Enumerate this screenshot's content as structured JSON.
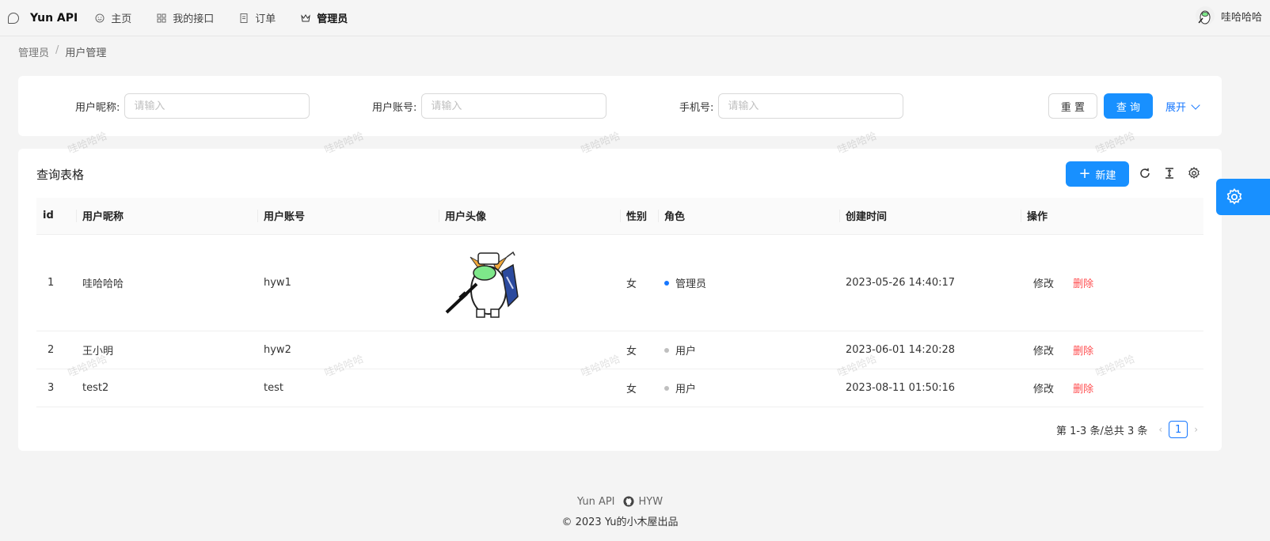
{
  "app": {
    "title": "Yun API"
  },
  "nav": [
    {
      "label": "主页",
      "icon": "smile-icon"
    },
    {
      "label": "我的接口",
      "icon": "apps-icon"
    },
    {
      "label": "订单",
      "icon": "file-icon"
    },
    {
      "label": "管理员",
      "icon": "crown-icon"
    }
  ],
  "user": {
    "name": "哇哈哈哈"
  },
  "breadcrumb": [
    "管理员",
    "用户管理"
  ],
  "breadcrumb_sep": "/",
  "search": {
    "nickname_label": "用户昵称:",
    "account_label": "用户账号:",
    "phone_label": "手机号:",
    "placeholder": "请输入",
    "reset_label": "重 置",
    "query_label": "查 询",
    "expand_label": "展开"
  },
  "table_card": {
    "title": "查询表格",
    "new_label": "新建",
    "new_icon": "plus-icon",
    "tools": [
      "reload-icon",
      "column-height-icon",
      "setting-icon"
    ]
  },
  "table": {
    "columns": [
      "id",
      "用户昵称",
      "用户账号",
      "用户头像",
      "性别",
      "角色",
      "创建时间",
      "操作"
    ],
    "rows": [
      {
        "id": "1",
        "nickname": "哇哈哈哈",
        "account": "hyw1",
        "has_avatar": true,
        "gender": "女",
        "role": "管理员",
        "role_color": "#1677ff",
        "created": "2023-05-26 14:40:17"
      },
      {
        "id": "2",
        "nickname": "王小明",
        "account": "hyw2",
        "has_avatar": false,
        "gender": "女",
        "role": "用户",
        "role_color": "#bfbfbf",
        "created": "2023-06-01 14:20:28"
      },
      {
        "id": "3",
        "nickname": "test2",
        "account": "test",
        "has_avatar": false,
        "gender": "女",
        "role": "用户",
        "role_color": "#bfbfbf",
        "created": "2023-08-11 01:50:16"
      }
    ],
    "edit_label": "修改",
    "delete_label": "删除"
  },
  "pagination": {
    "summary": "第 1-3 条/总共 3 条",
    "current": "1"
  },
  "footer": {
    "brand": "Yun API",
    "github_label": "HYW",
    "copyright": "© 2023 Yu的小木屋出品"
  },
  "watermark_text": "哇哈哈哈",
  "colors": {
    "primary": "#1890ff",
    "danger": "#ff4d4f"
  }
}
